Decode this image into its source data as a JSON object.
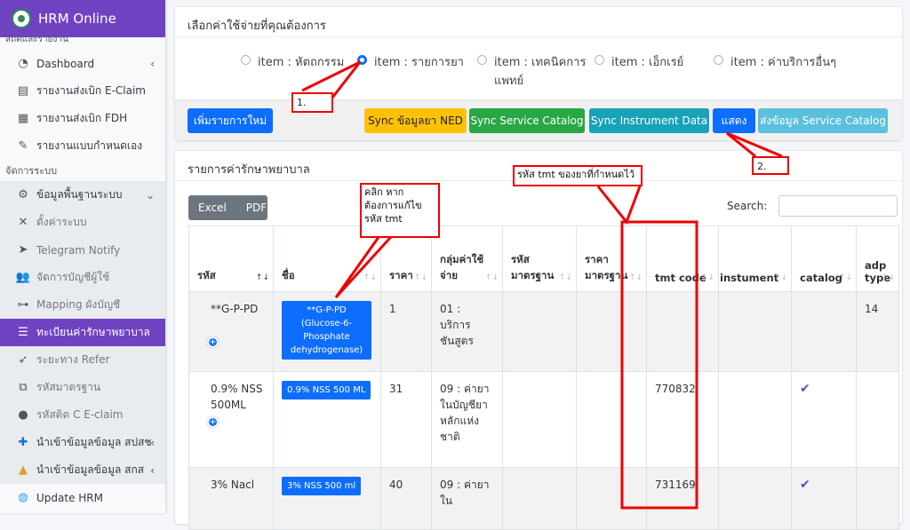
{
  "brand": {
    "title": "HRM Online"
  },
  "sidebar": {
    "cut_label": "สถิติและรายงาน",
    "items": [
      {
        "label": "Dashboard",
        "icon": "dashboard-icon"
      },
      {
        "label": "รายงานส่งเบิก E-Claim",
        "icon": "report-icon"
      },
      {
        "label": "รายงานส่งเบิก FDH",
        "icon": "report-icon"
      },
      {
        "label": "รายงานแบบกำหนดเอง",
        "icon": "custom-report-icon"
      }
    ],
    "section_label": "จัดการระบบ",
    "group_label": "ข้อมูลพื้นฐานระบบ",
    "sub_items": [
      {
        "label": "ตั้งค่าระบบ"
      },
      {
        "label": "Telegram Notify"
      },
      {
        "label": "จัดการบัญชีผู้ใช้"
      },
      {
        "label": "Mapping ผังบัญชี"
      },
      {
        "label": "ทะเบียนค่ารักษาพยาบาล"
      },
      {
        "label": "ระยะทาง Refer"
      },
      {
        "label": "รหัสมาตรฐาน"
      },
      {
        "label": "รหัสติด C E-claim"
      },
      {
        "label": "นำเข้าข้อมูลข้อมูล สปสช"
      },
      {
        "label": "นำเข้าข้อมูลข้อมูล สกส"
      },
      {
        "label": "Update HRM"
      }
    ]
  },
  "filter": {
    "title": "เลือกค่าใช้จ่ายที่คุณต้องการ",
    "options": [
      {
        "label": "item : หัตถกรรม",
        "selected": false
      },
      {
        "label": "item : รายการยา",
        "selected": true
      },
      {
        "label": "item : เทคนิคการแพทย์",
        "selected": false
      },
      {
        "label": "item : เอ็กเรย์",
        "selected": false
      },
      {
        "label": "item : ค่าบริการอื่นๆ",
        "selected": false
      }
    ],
    "buttons": {
      "add": "เพิ่มรายการใหม่",
      "sync_ned": "Sync ข้อมูลยา NED",
      "sync_service": "Sync Service Catalog",
      "sync_instrument": "Sync Instrument Data",
      "show": "แสดง",
      "send_service": "ส่งข้อมูล Service Catalog"
    }
  },
  "list": {
    "title": "รายการค่ารักษาพยาบาล",
    "export": {
      "excel": "Excel",
      "pdf": "PDF"
    },
    "search_label": "Search:",
    "columns": [
      "รหัส",
      "ชื่อ",
      "ราคา",
      "กลุ่มค่าใช้จ่าย",
      "รหัสมาตรฐาน",
      "ราคามาตรฐาน",
      "tmt code",
      "instument",
      "catalog",
      "adp type"
    ],
    "rows": [
      {
        "code": "**G-P-PD",
        "name": "**G-P-PD (Glucose-6-Phosphate dehydrogenase)",
        "price": "1",
        "group": "01 : บริการชันสูตร",
        "std_code": "",
        "std_price": "",
        "tmt": "",
        "instrument": "",
        "catalog": false,
        "adp": "14"
      },
      {
        "code": "0.9% NSS 500ML",
        "name": "0.9% NSS 500 ML",
        "price": "31",
        "group": "09 : ค่ายาในบัญชียาหลักแห่งชาติ",
        "std_code": "",
        "std_price": "",
        "tmt": "770832",
        "instrument": "",
        "catalog": true,
        "adp": ""
      },
      {
        "code": "3% Nacl",
        "name": "3% NSS 500 ml",
        "price": "40",
        "group": "09 : ค่ายาใน",
        "std_code": "",
        "std_price": "",
        "tmt": "731169",
        "instrument": "",
        "catalog": true,
        "adp": ""
      }
    ]
  },
  "annotations": {
    "step1": "1.",
    "step2": "2.",
    "click_note": "คลิก หากต้องการแก้ไขรหัส tmt",
    "tmt_note": "รหัส tmt ของยาที่กำหนดไว้"
  },
  "colors": {
    "brand": "#6f42c1",
    "primary": "#0d6efd",
    "annotation": "#e00000"
  }
}
